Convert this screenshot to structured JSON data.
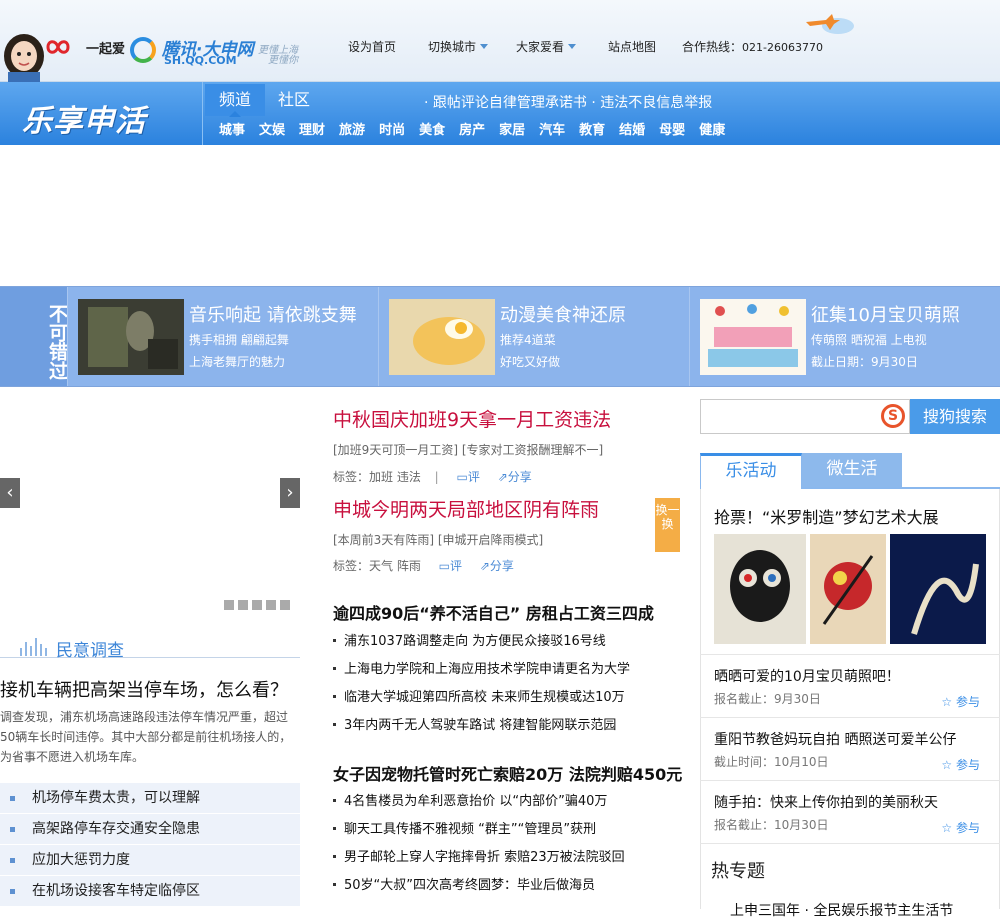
{
  "header": {
    "brand_17": "一起爱",
    "brand_qq": "腾讯·大申网",
    "brand_qq_sub": "SH.QQ.COM",
    "slogan_1": "更懂上海",
    "slogan_2": "更懂你",
    "nav": [
      {
        "label": "设为首页"
      },
      {
        "label": "切换城市"
      },
      {
        "label": "大家爱看"
      },
      {
        "label": "站点地图"
      }
    ],
    "hotline_label": "合作热线：",
    "hotline": "021-26063770"
  },
  "navbar": {
    "logo": "乐享申活",
    "tab_active": "频道",
    "tab_other": "社区",
    "notice": "· 跟帖评论自律管理承诺书 · 违法不良信息举报",
    "channels": [
      "城事",
      "文娱",
      "理财",
      "旅游",
      "时尚",
      "美食",
      "房产",
      "家居",
      "汽车",
      "教育",
      "结婚",
      "母婴",
      "健康"
    ]
  },
  "banner": {
    "title": "不可错过",
    "items": [
      {
        "title": "音乐响起 请依跳支舞",
        "line1": "携手相拥  翩翩起舞",
        "line2": "上海老舞厅的魅力"
      },
      {
        "title": "动漫美食神还原",
        "line1": "推荐4道菜",
        "line2": "好吃又好做"
      },
      {
        "title": "征集10月宝贝萌照",
        "line1": "传萌照  晒祝福  上电视",
        "line2": "截止日期：9月30日"
      }
    ]
  },
  "poll": {
    "title": "民意调查",
    "question": "接机车辆把高架当停车场，怎么看？",
    "desc": "调查发现，浦东机场高速路段违法停车情况严重，超过50辆车长时间违停。其中大部分都是前往机场接人的，为省事不愿进入机场车库。",
    "options": [
      "机场停车费太贵，可以理解",
      "高架路停车存交通安全隐患",
      "应加大惩罚力度",
      "在机场设接客车特定临停区"
    ]
  },
  "main": {
    "headline1": {
      "title": "中秋国庆加班9天拿一月工资违法",
      "sub": "[加班9天可顶一月工资]  [专家对工资报酬理解不一]",
      "tag_label": "标签：",
      "tags": "加班  违法",
      "comment": "评",
      "share": "分享"
    },
    "headline2": {
      "title": "申城今明两天局部地区阴有阵雨",
      "sub": "[本周前3天有阵雨]  [申城开启降雨模式]",
      "tag_label": "标签：",
      "tags": "天气  阵雨",
      "comment": "评",
      "share": "分享"
    },
    "swap": "换一换",
    "section1": {
      "title": "逾四成90后“养不活自己” 房租占工资三四成",
      "items": [
        "浦东1037路调整走向 为方便民众接驳16号线",
        "上海电力学院和上海应用技术学院申请更名为大学",
        "临港大学城迎第四所高校 未来师生规模或达10万",
        "3年内两千无人驾驶车路试 将建智能网联示范园"
      ]
    },
    "section2": {
      "title": "女子因宠物托管时死亡索赔20万 法院判赔450元",
      "items": [
        "4名售楼员为牟利恶意抬价 以“内部价”骗40万",
        "聊天工具传播不雅视频 “群主”“管理员”获刑",
        "男子邮轮上穿人字拖摔骨折 索赔23万被法院驳回",
        "50岁“大叔”四次高考终圆梦：毕业后做海员"
      ]
    }
  },
  "sidebar": {
    "search_placeholder": "",
    "search_button": "搜狗搜索",
    "tabs": [
      "乐活动",
      "微生活"
    ],
    "feature_title": "抢票！“米罗制造”梦幻艺术大展",
    "activities": [
      {
        "title": "晒晒可爱的10月宝贝萌照吧！",
        "date": "报名截止：9月30日",
        "action": "参与"
      },
      {
        "title": "重阳节教爸妈玩自拍 晒照送可爱羊公仔",
        "date": "截止时间：10月10日",
        "action": "参与"
      },
      {
        "title": "随手拍：快来上传你拍到的美丽秋天",
        "date": "报名截止：10月30日",
        "action": "参与"
      }
    ],
    "hot_title": "热专题",
    "hot_line": "上申三国年 · 全民娱乐报节主生活节"
  },
  "colors": {
    "accent": "#3a8ee6",
    "headline": "#c8103e",
    "banner": "#8cb4ec",
    "swap": "#f4ad46"
  }
}
